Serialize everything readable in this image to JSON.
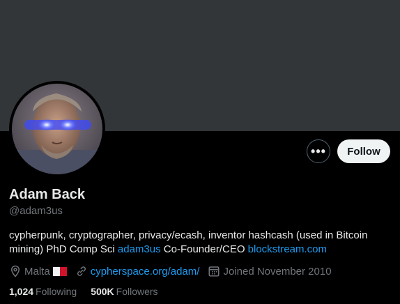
{
  "profile": {
    "name": "Adam Back",
    "handle": "@adam3us",
    "bio": {
      "text1": "cypherpunk, cryptographer, privacy/ecash, inventor hashcash (used in Bitcoin mining) PhD Comp Sci ",
      "link1": "adam3us",
      "text2": " Co-Founder/CEO ",
      "link2": "blockstream.com"
    },
    "location": "Malta",
    "website": "cypherspace.org/adam/",
    "joined": "Joined November 2010",
    "following_count": "1,024",
    "following_label": "Following",
    "followers_count": "500K",
    "followers_label": "Followers"
  },
  "actions": {
    "more_label": "•••",
    "follow_label": "Follow"
  },
  "colors": {
    "accent": "#1d9bf0",
    "banner": "#333639",
    "muted": "#71767b"
  },
  "icons": [
    "more-icon",
    "location-icon",
    "malta-flag-icon",
    "link-icon",
    "calendar-icon"
  ]
}
